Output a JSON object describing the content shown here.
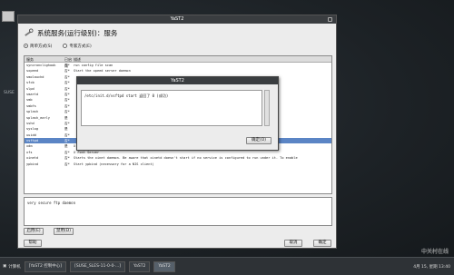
{
  "desktop": {
    "label": "SUSE"
  },
  "window": {
    "title": "YaST2",
    "heading": "系统服务(运行级别)：服务",
    "mode_simple": "简单方式(S)",
    "mode_expert": "专家方式(E)",
    "columns": [
      "服务",
      "已启用",
      "描述"
    ],
    "rows": [
      [
        "syncronclighook",
        "否*",
        "run config file scan"
      ],
      [
        "sxpeed",
        "否*",
        "Start the xpeed server daemon"
      ],
      [
        "smolauchd",
        "否*",
        ""
      ],
      [
        "sfcb",
        "否*",
        ""
      ],
      [
        "slpd",
        "否*",
        ""
      ],
      [
        "smartd",
        "否*",
        ""
      ],
      [
        "smb",
        "否*",
        ""
      ],
      [
        "smbfs",
        "否*",
        ""
      ],
      [
        "splash",
        "否*",
        ""
      ],
      [
        "splash_early",
        "是",
        ""
      ],
      [
        "sshd",
        "否*",
        ""
      ],
      [
        "syslog",
        "是",
        ""
      ],
      [
        "uuidd",
        "否*",
        ""
      ],
      [
        "vsftpd",
        "否*",
        ""
      ],
      [
        "xdm",
        "是",
        "X Display Manager"
      ],
      [
        "xfs",
        "否*",
        "X Font Server"
      ],
      [
        "xinetd",
        "否*",
        "Starts the xinet daemon. Be aware that xinetd doesn't start if no service is configured to run under it. To enable"
      ],
      [
        "ypbind",
        "否*",
        "Start ypbind (necessary for a NIS client)"
      ]
    ],
    "selected_index": 13,
    "description": "very secure ftp daemon",
    "enable_btn": "启用(E)",
    "disable_btn": "禁用(D)",
    "help_btn": "帮助",
    "cancel_btn": "取消",
    "ok_btn": "确定"
  },
  "dialog": {
    "title": "YaST2",
    "message": "/etc/init.d/vsftpd start 返回了 0 (成功)",
    "ok_btn": "确定(O)"
  },
  "taskbar": {
    "start": "计算机",
    "items": [
      "[YaST2 控制中心]",
      "[SUSE_SLES-11-0-0-...]",
      "YaST2",
      "YaST2"
    ],
    "clock": "4月 15, 星期 13:40"
  },
  "watermark": "中关村在线"
}
